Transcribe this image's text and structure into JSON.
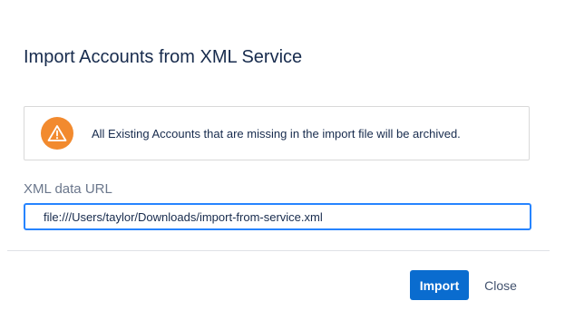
{
  "dialog": {
    "title": "Import Accounts from XML Service"
  },
  "warning": {
    "icon": "warning-triangle-icon",
    "message": "All Existing Accounts that are missing in the import file will be archived.",
    "icon_color": "#f28a2e"
  },
  "form": {
    "url_label": "XML data URL",
    "url_value": "file:///Users/taylor/Downloads/import-from-service.xml"
  },
  "footer": {
    "import_label": "Import",
    "close_label": "Close"
  },
  "colors": {
    "primary": "#0a6ccf",
    "focus_border": "#2684ff",
    "warning": "#f28a2e"
  }
}
